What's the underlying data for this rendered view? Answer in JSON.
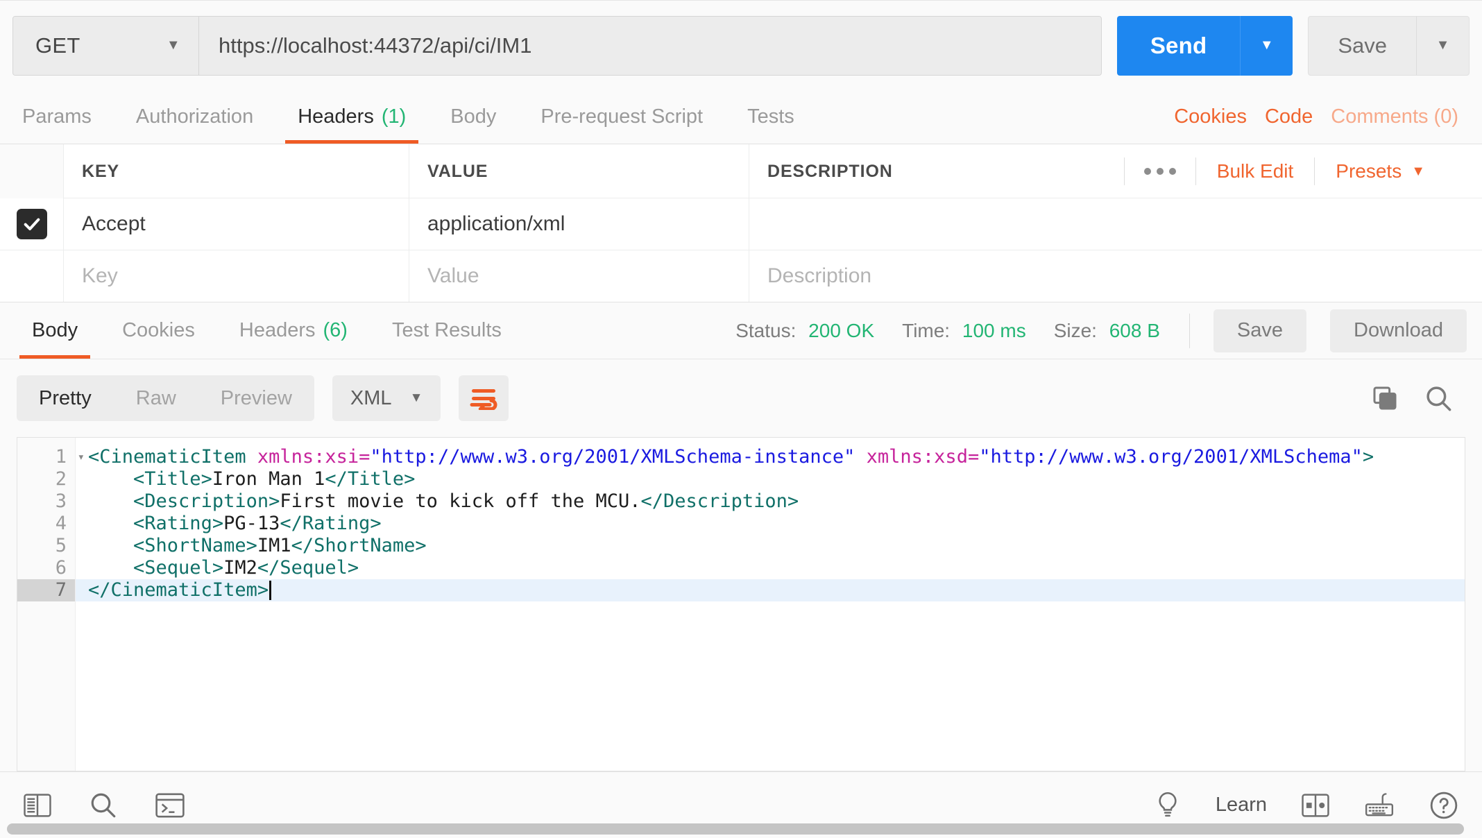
{
  "request": {
    "method": "GET",
    "method_caret": "▼",
    "url": "https://localhost:44372/api/ci/IM1",
    "send_label": "Send",
    "send_caret": "▼",
    "save_label": "Save",
    "save_caret": "▼"
  },
  "request_tabs": [
    {
      "label": "Params",
      "count": "",
      "active": false
    },
    {
      "label": "Authorization",
      "count": "",
      "active": false
    },
    {
      "label": "Headers",
      "count": "(1)",
      "active": true
    },
    {
      "label": "Body",
      "count": "",
      "active": false
    },
    {
      "label": "Pre-request Script",
      "count": "",
      "active": false
    },
    {
      "label": "Tests",
      "count": "",
      "active": false
    }
  ],
  "request_tabs_right": {
    "cookies": "Cookies",
    "code": "Code",
    "comments": "Comments (0)"
  },
  "headers_table": {
    "columns": {
      "key": "KEY",
      "value": "VALUE",
      "description": "DESCRIPTION"
    },
    "tools": {
      "more": "•••",
      "bulk_edit": "Bulk Edit",
      "presets": "Presets",
      "presets_caret": "▼"
    },
    "rows": [
      {
        "checked": true,
        "key": "Accept",
        "value": "application/xml",
        "description": ""
      }
    ],
    "placeholder_row": {
      "key": "Key",
      "value": "Value",
      "description": "Description"
    }
  },
  "response_tabs": [
    {
      "label": "Body",
      "count": "",
      "active": true
    },
    {
      "label": "Cookies",
      "count": "",
      "active": false
    },
    {
      "label": "Headers",
      "count": "(6)",
      "active": false
    },
    {
      "label": "Test Results",
      "count": "",
      "active": false
    }
  ],
  "response_meta": {
    "status_label": "Status:",
    "status_value": "200 OK",
    "time_label": "Time:",
    "time_value": "100 ms",
    "size_label": "Size:",
    "size_value": "608 B",
    "save_label": "Save",
    "download_label": "Download"
  },
  "view_toolbar": {
    "modes": [
      {
        "label": "Pretty",
        "active": true
      },
      {
        "label": "Raw",
        "active": false
      },
      {
        "label": "Preview",
        "active": false
      }
    ],
    "format": "XML",
    "format_caret": "▼",
    "wrap_icon": "word-wrap-icon",
    "copy_icon": "copy-icon",
    "search_icon": "search-icon"
  },
  "code": {
    "language": "xml",
    "current_line": 7,
    "lines": [
      {
        "n": "1",
        "fold": "▾",
        "indent": 0,
        "tokens": [
          {
            "t": "tag",
            "s": "<CinematicItem "
          },
          {
            "t": "attr",
            "s": "xmlns:xsi="
          },
          {
            "t": "str",
            "s": "\"http://www.w3.org/2001/XMLSchema-instance\""
          },
          {
            "t": "attr",
            "s": " xmlns:xsd="
          },
          {
            "t": "str",
            "s": "\"http://www.w3.org/2001/XMLSchema\""
          },
          {
            "t": "tag",
            "s": ">"
          }
        ]
      },
      {
        "n": "2",
        "fold": "",
        "indent": 1,
        "tokens": [
          {
            "t": "tag",
            "s": "<Title>"
          },
          {
            "t": "txt",
            "s": "Iron Man 1"
          },
          {
            "t": "tag",
            "s": "</Title>"
          }
        ]
      },
      {
        "n": "3",
        "fold": "",
        "indent": 1,
        "tokens": [
          {
            "t": "tag",
            "s": "<Description>"
          },
          {
            "t": "txt",
            "s": "First movie to kick off the MCU."
          },
          {
            "t": "tag",
            "s": "</Description>"
          }
        ]
      },
      {
        "n": "4",
        "fold": "",
        "indent": 1,
        "tokens": [
          {
            "t": "tag",
            "s": "<Rating>"
          },
          {
            "t": "txt",
            "s": "PG-13"
          },
          {
            "t": "tag",
            "s": "</Rating>"
          }
        ]
      },
      {
        "n": "5",
        "fold": "",
        "indent": 1,
        "tokens": [
          {
            "t": "tag",
            "s": "<ShortName>"
          },
          {
            "t": "txt",
            "s": "IM1"
          },
          {
            "t": "tag",
            "s": "</ShortName>"
          }
        ]
      },
      {
        "n": "6",
        "fold": "",
        "indent": 1,
        "tokens": [
          {
            "t": "tag",
            "s": "<Sequel>"
          },
          {
            "t": "txt",
            "s": "IM2"
          },
          {
            "t": "tag",
            "s": "</Sequel>"
          }
        ]
      },
      {
        "n": "7",
        "fold": "",
        "indent": 0,
        "tokens": [
          {
            "t": "tag",
            "s": "</CinematicItem>"
          }
        ],
        "cursor": true
      }
    ]
  },
  "bottom_bar": {
    "sidebar_toggle_icon": "sidebar-toggle-icon",
    "find_icon": "search-icon",
    "console_icon": "console-icon",
    "bulb_icon": "lightbulb-icon",
    "learn_label": "Learn",
    "layout_icon": "two-pane-layout-icon",
    "keyboard_icon": "keyboard-shortcuts-icon",
    "help_icon": "help-icon"
  },
  "colors": {
    "accent_orange": "#ef5b25",
    "send_blue": "#1e87f0",
    "status_green": "#22b573",
    "tag_teal": "#107068",
    "attr_magenta": "#c6239b",
    "string_blue": "#1a1ae0"
  }
}
